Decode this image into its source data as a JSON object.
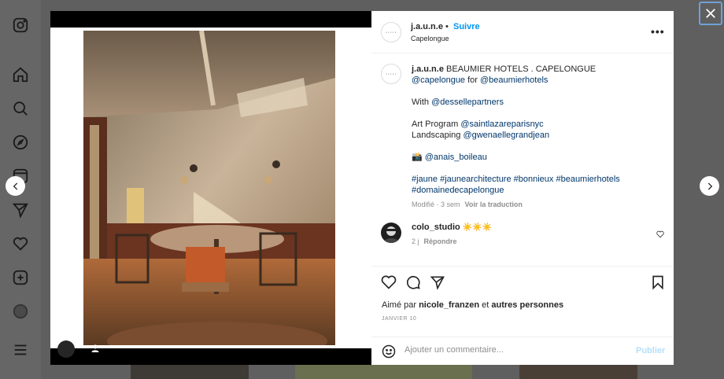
{
  "nav": {
    "icons": [
      "instagram-icon",
      "home-icon",
      "search-icon",
      "explore-icon",
      "reels-icon",
      "messages-icon",
      "notifications-icon",
      "create-icon",
      "profile-avatar",
      "menu-icon"
    ]
  },
  "post": {
    "username": "j.a.u.n.e",
    "follow_label": "Suivre",
    "location": "Capelongue",
    "more_label": "•••",
    "avatar_text": "·····"
  },
  "caption": {
    "username": "j.a.u.n.e",
    "lines": [
      "BEAUMIER HOTELS . CAPELONGUE",
      "",
      "",
      "With ",
      "",
      "Art Program ",
      "Landscaping ",
      "",
      "📸 ",
      "",
      ""
    ],
    "line1_text": "BEAUMIER HOTELS . CAPELONGUE",
    "line2_link1": "@capelongue",
    "line2_for": " for ",
    "line2_link2": "@beaumierhotels",
    "with_text": "With ",
    "with_link": "@dessellepartners",
    "art_text": "Art Program ",
    "art_link": "@saintlazareparisnyc",
    "land_text": "Landscaping ",
    "land_link": "@gwenaellegrandjean",
    "photo_emoji": "📸 ",
    "photo_link": "@anais_boileau",
    "hashtags1": "#jaune #jaunearchitecture #bonnieux #beaumierhotels",
    "hashtags2": "#domainedecapelongue",
    "modified": "Modifié · 3 sem",
    "see_translation": "Voir la traduction"
  },
  "comment": {
    "username": "colo_studio",
    "suns": "☀️☀️☀️",
    "age": "2 j",
    "reply": "Répondre"
  },
  "likes": {
    "prefix": "Aimé par ",
    "user": "nicole_franzen",
    "middle": " et ",
    "rest": "autres personnes"
  },
  "date": "JANVIER 10",
  "add_comment": {
    "placeholder": "Ajouter un commentaire...",
    "post_label": "Publier"
  },
  "colors": {
    "accent": "#0095f6",
    "link": "#00376b",
    "muted": "#8e8e8e"
  }
}
